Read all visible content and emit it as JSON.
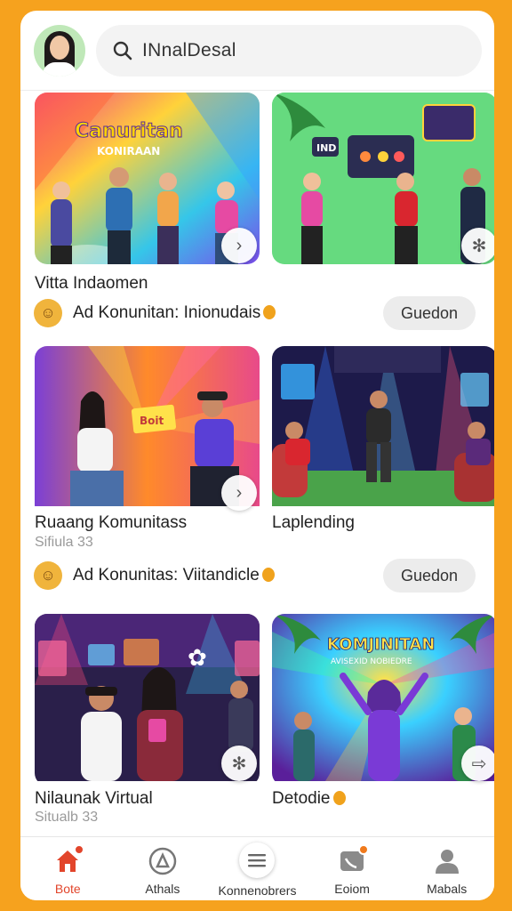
{
  "header": {
    "search_text": "INnalDesal"
  },
  "feed": [
    {
      "title": "Vitta Indaomen",
      "subtitle": "",
      "image_text": "Canuritan KONIRAAN",
      "sign_text": "IND",
      "action_icon": "chevron-right-icon"
    },
    {
      "title": "",
      "subtitle": "",
      "image_text": "",
      "sign_text": "",
      "action_icon": "settings-icon"
    },
    {
      "title": "Ruaang Komunitass",
      "subtitle": "Sifiula 33",
      "image_text": "Boit",
      "action_icon": "chevron-right-icon"
    },
    {
      "title": "Laplending",
      "subtitle": "",
      "image_text": "",
      "action_icon": ""
    },
    {
      "title": "Nilaunak Virtual",
      "subtitle": "Situalb 33",
      "image_text": "",
      "action_icon": "settings-icon"
    },
    {
      "title": "Detodie",
      "subtitle": "",
      "image_text": "KOMJINITAN",
      "image_subtext": "AVISEXID NOBIEDRE",
      "action_icon": "share-icon"
    }
  ],
  "ads": [
    {
      "text": "Ad Konunitan: Inionudais",
      "button": "Guedon"
    },
    {
      "text": "Ad Konunitas: Viitandicle",
      "button": "Guedon"
    }
  ],
  "nav": [
    {
      "label": "Bote",
      "icon": "home-icon",
      "active": true
    },
    {
      "label": "Athals",
      "icon": "compass-icon",
      "active": false
    },
    {
      "label": "Konnenobrers",
      "icon": "menu-icon",
      "active": false
    },
    {
      "label": "Eoiom",
      "icon": "chat-icon",
      "active": false
    },
    {
      "label": "Mabals",
      "icon": "profile-icon",
      "active": false
    }
  ],
  "colors": {
    "background": "#F6A21E",
    "accent": "#E2452B",
    "button_gray": "#ECECEC"
  }
}
